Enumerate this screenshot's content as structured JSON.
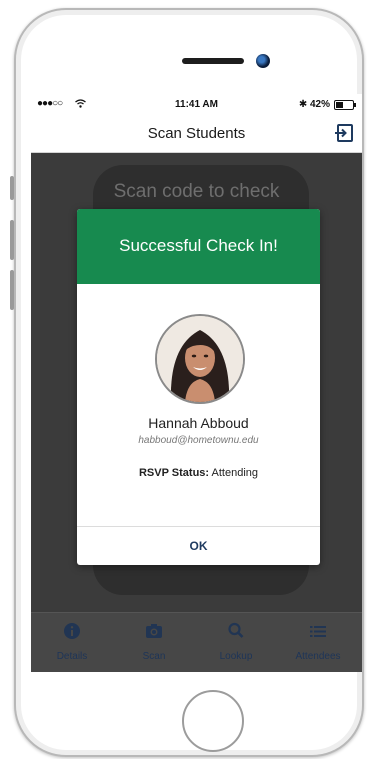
{
  "status_bar": {
    "signal": "●●●○○",
    "time": "11:41 AM",
    "battery_text": "✱ 42%",
    "battery_level": 0.42
  },
  "nav": {
    "title": "Scan Students",
    "exit_icon": "exit-icon"
  },
  "camera": {
    "hint": "Scan code to check"
  },
  "modal": {
    "title": "Successful Check In!",
    "name": "Hannah Abboud",
    "email": "habboud@hometownu.edu",
    "rsvp_label": "RSVP Status:",
    "rsvp_value": "Attending",
    "ok_label": "OK"
  },
  "tabs": [
    {
      "label": "Details",
      "icon": "info-icon"
    },
    {
      "label": "Scan",
      "icon": "camera-icon"
    },
    {
      "label": "Lookup",
      "icon": "search-icon"
    },
    {
      "label": "Attendees",
      "icon": "list-icon"
    }
  ],
  "colors": {
    "header_green": "#178a4f",
    "dark_overlay": "#3b3b3b",
    "tab_icon": "#213553"
  }
}
